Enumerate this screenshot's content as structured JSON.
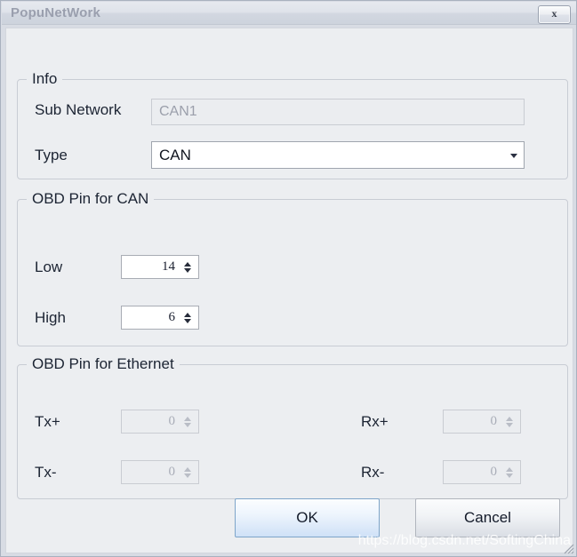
{
  "window": {
    "title": "PopuNetWork",
    "close_label": "x"
  },
  "groups": {
    "info": {
      "title": "Info",
      "sub_network": {
        "label": "Sub Network",
        "value": "CAN1",
        "disabled": true
      },
      "type": {
        "label": "Type",
        "value": "CAN",
        "options": [
          "CAN"
        ]
      }
    },
    "obd_pin_can": {
      "title": "OBD Pin for CAN",
      "low": {
        "label": "Low",
        "value": "14"
      },
      "high": {
        "label": "High",
        "value": "6"
      }
    },
    "obd_pin_ethernet": {
      "title": "OBD Pin for Ethernet",
      "tx_plus": {
        "label": "Tx+",
        "value": "0",
        "disabled": true
      },
      "tx_minus": {
        "label": "Tx-",
        "value": "0",
        "disabled": true
      },
      "rx_plus": {
        "label": "Rx+",
        "value": "0",
        "disabled": true
      },
      "rx_minus": {
        "label": "Rx-",
        "value": "0",
        "disabled": true
      }
    }
  },
  "buttons": {
    "ok": "OK",
    "cancel": "Cancel"
  },
  "watermark": "https://blog.csdn.net/SoftingChina",
  "colors": {
    "accent": "#cfe1f7",
    "title_text": "#9a9fae",
    "label_text": "#1c2433",
    "panel_bg": "#eceef1",
    "disabled_text": "#a9adb8"
  }
}
